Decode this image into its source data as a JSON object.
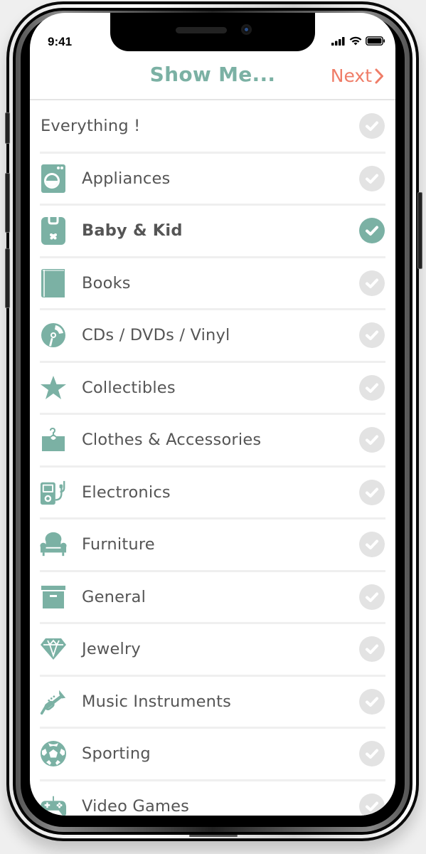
{
  "status_bar": {
    "time": "9:41",
    "icons": [
      "signal-icon",
      "wifi-icon",
      "battery-icon"
    ]
  },
  "header": {
    "title": "Show Me...",
    "next_label": "Next",
    "next_icon": "chevron-right-icon"
  },
  "colors": {
    "accent": "#7bb1a4",
    "next": "#ef7d68",
    "check_off": "#e3e3e3",
    "text": "#555555"
  },
  "categories": [
    {
      "label": "Everything !",
      "icon": null,
      "selected": false
    },
    {
      "label": "Appliances",
      "icon": "washing-machine-icon",
      "selected": false
    },
    {
      "label": "Baby & Kid",
      "icon": "baby-bib-icon",
      "selected": true
    },
    {
      "label": "Books",
      "icon": "book-icon",
      "selected": false
    },
    {
      "label": "CDs / DVDs / Vinyl",
      "icon": "disc-icon",
      "selected": false
    },
    {
      "label": "Collectibles",
      "icon": "star-icon",
      "selected": false
    },
    {
      "label": "Clothes & Accessories",
      "icon": "hanger-box-icon",
      "selected": false
    },
    {
      "label": "Electronics",
      "icon": "mp3-player-icon",
      "selected": false
    },
    {
      "label": "Furniture",
      "icon": "armchair-icon",
      "selected": false
    },
    {
      "label": "General",
      "icon": "archive-box-icon",
      "selected": false
    },
    {
      "label": "Jewelry",
      "icon": "diamond-icon",
      "selected": false
    },
    {
      "label": "Music Instruments",
      "icon": "trumpet-icon",
      "selected": false
    },
    {
      "label": "Sporting",
      "icon": "soccer-ball-icon",
      "selected": false
    },
    {
      "label": "Video Games",
      "icon": "gamepad-icon",
      "selected": false
    }
  ]
}
